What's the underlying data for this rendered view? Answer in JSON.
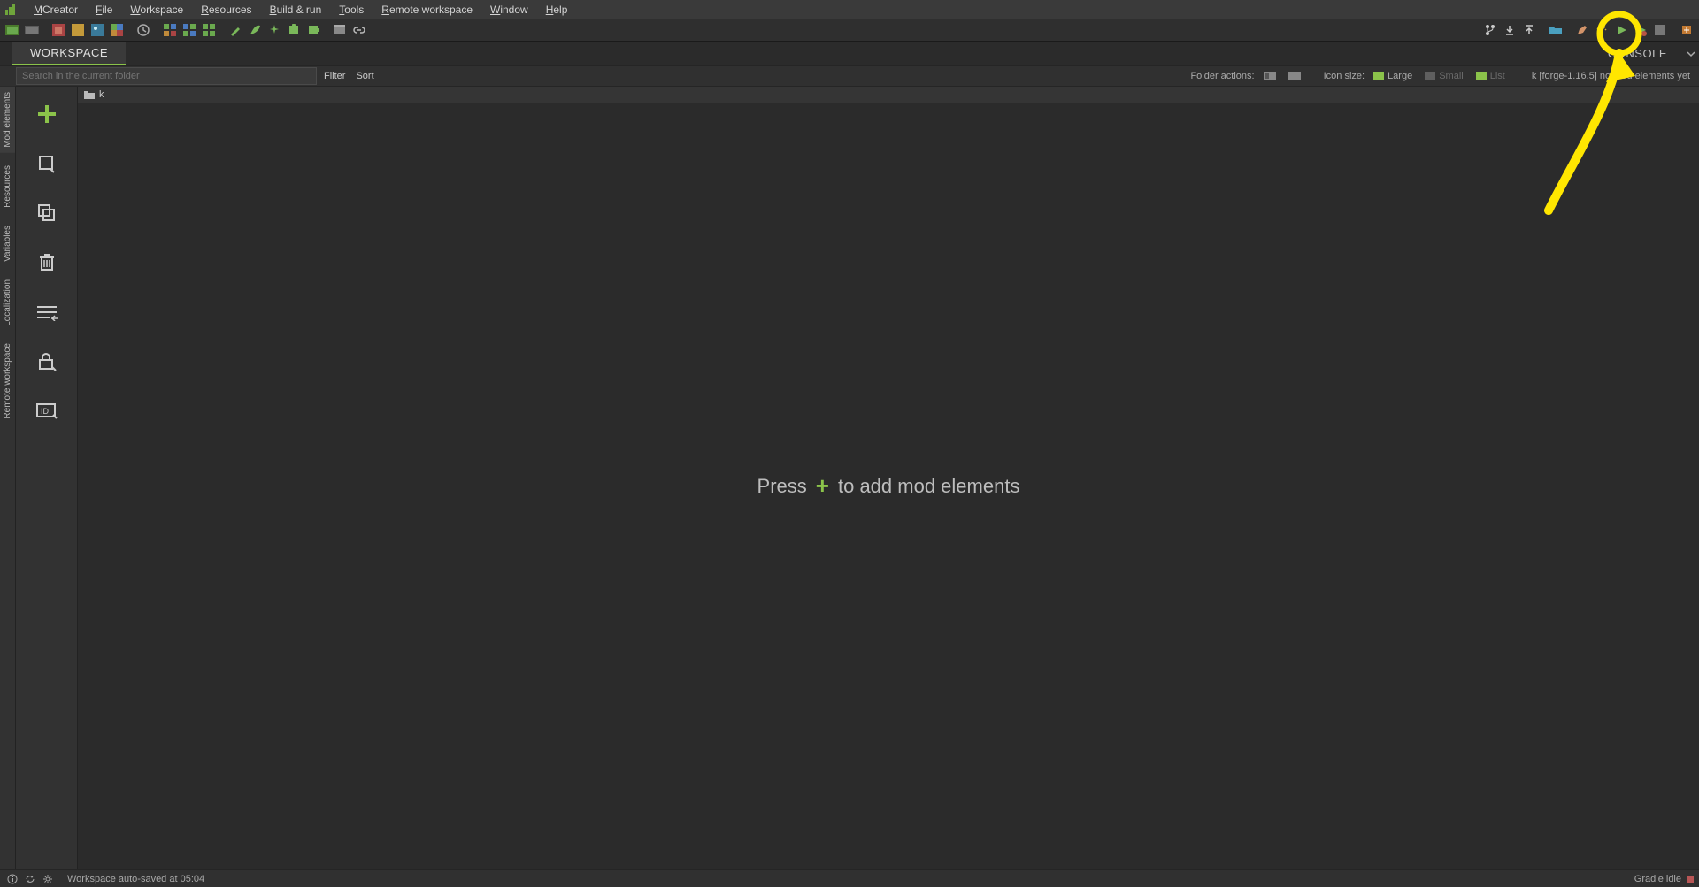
{
  "menu": {
    "app_title": "MCreator",
    "items": [
      "File",
      "Workspace",
      "Resources",
      "Build & run",
      "Tools",
      "Remote workspace",
      "Window",
      "Help"
    ]
  },
  "tabs": {
    "workspace": "WORKSPACE",
    "console": "CONSOLE"
  },
  "strip": {
    "search_placeholder": "Search in the current folder",
    "filter_label": "Filter",
    "sort_label": "Sort",
    "folder_actions_label": "Folder actions:",
    "icon_size_label": "Icon size:",
    "size_large": "Large",
    "size_small": "Small",
    "size_list": "List",
    "status": "k [forge-1.16.5] no mod elements yet"
  },
  "breadcrumb": {
    "root": "k"
  },
  "left_rail": {
    "sections": [
      "Mod elements",
      "Resources",
      "Variables",
      "Localization",
      "Remote workspace"
    ]
  },
  "center": {
    "press": "Press",
    "msg": "to add mod elements"
  },
  "status": {
    "msg": "Workspace auto-saved at 05:04",
    "gradle": "Gradle idle"
  }
}
